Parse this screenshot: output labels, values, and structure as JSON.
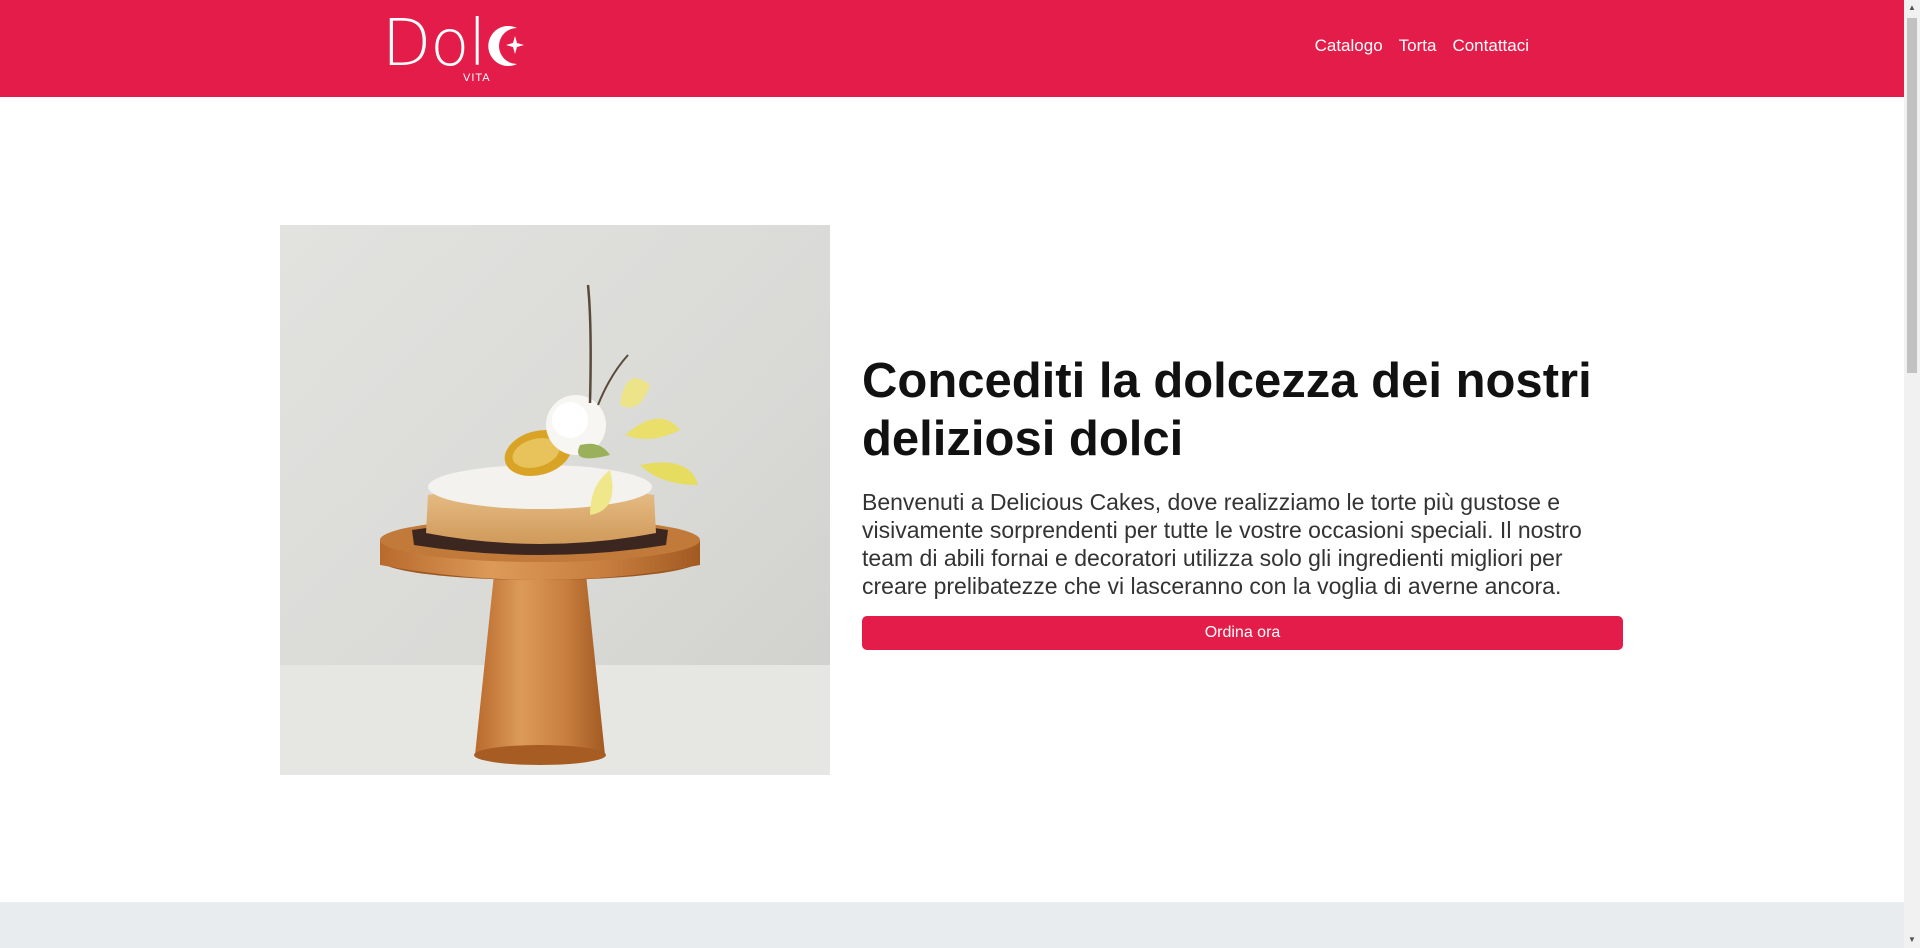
{
  "brand": {
    "name": "Dol",
    "suffix": "e",
    "tagline": "VITA"
  },
  "nav": {
    "items": [
      {
        "label": "Catalogo"
      },
      {
        "label": "Torta"
      },
      {
        "label": "Contattaci"
      }
    ]
  },
  "hero": {
    "title": "Concediti la dolcezza dei nostri deliziosi dolci",
    "description": "Benvenuti a Delicious Cakes, dove realizziamo le torte più gustose e visivamente sorprendenti per tutte le vostre occasioni speciali. Il nostro team di abili fornai e decoratori utilizza solo gli ingredienti migliori per creare prelibatezze che vi lasceranno con la voglia di averne ancora.",
    "button_label": "Ordina ora"
  },
  "colors": {
    "brand": "#e31c49",
    "band": "#e9ecef"
  },
  "icons": {
    "logo": "crescent-moon-star-icon",
    "scroll_up": "triangle-up-icon",
    "scroll_down": "triangle-down-icon"
  }
}
